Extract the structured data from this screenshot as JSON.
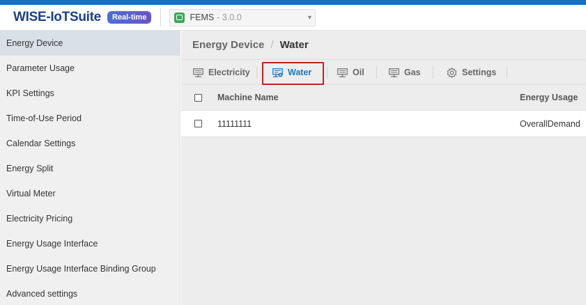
{
  "header": {
    "brand": "WISE-IoTSuite",
    "badge": "Real-time",
    "app_selector": {
      "name": "FEMS",
      "version": "- 3.0.0"
    }
  },
  "sidebar": {
    "items": [
      {
        "label": "Energy Device",
        "active": true
      },
      {
        "label": "Parameter Usage"
      },
      {
        "label": "KPI Settings"
      },
      {
        "label": "Time-of-Use Period"
      },
      {
        "label": "Calendar Settings"
      },
      {
        "label": "Energy Split"
      },
      {
        "label": "Virtual Meter"
      },
      {
        "label": "Electricity Pricing"
      },
      {
        "label": "Energy Usage Interface"
      },
      {
        "label": "Energy Usage Interface Binding Group"
      },
      {
        "label": "Advanced settings"
      }
    ]
  },
  "breadcrumb": {
    "parent": "Energy Device",
    "separator": "/",
    "current": "Water"
  },
  "tabs": [
    {
      "label": "Electricity",
      "icon": "meter-icon"
    },
    {
      "label": "Water",
      "icon": "meter-gear-icon",
      "active": true
    },
    {
      "label": "Oil",
      "icon": "meter-icon"
    },
    {
      "label": "Gas",
      "icon": "meter-icon"
    },
    {
      "label": "Settings",
      "icon": "gear-icon"
    }
  ],
  "table": {
    "columns": [
      "Machine Name",
      "Energy Usage"
    ],
    "rows": [
      {
        "machine_name": "11111111",
        "energy_usage": "OverallDemand"
      }
    ]
  },
  "colors": {
    "accent": "#1a78c2",
    "brand": "#1c3f8a",
    "highlight_box": "#c81e1e"
  }
}
